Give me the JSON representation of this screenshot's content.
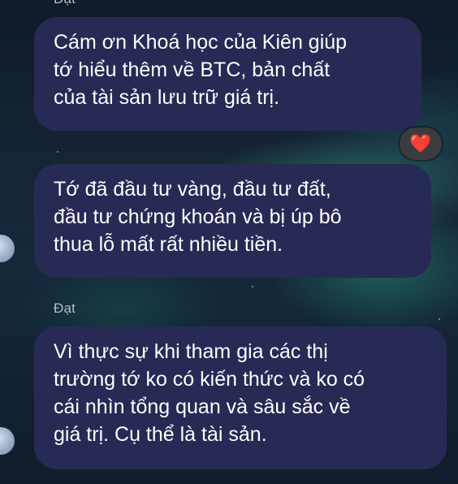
{
  "messages": [
    {
      "sender": "Đạt",
      "lines": [
        "Cám ơn Khoá học của Kiên giúp",
        "tớ hiểu thêm về BTC, bản chất",
        "của tài sản lưu trữ giá trị."
      ],
      "reaction": "❤️"
    },
    {
      "lines": [
        "Tớ đã đầu tư vàng, đầu tư đất,",
        "đầu tư chứng khoán và bị úp bô",
        "thua lỗ mất rất nhiều tiền."
      ]
    },
    {
      "sender": "Đạt",
      "lines": [
        "Vì thực sự khi tham gia các thị",
        "trường tớ ko có kiến thức và ko có",
        "cái nhìn tổng quan và sâu sắc về",
        "giá trị. Cụ thể là tài sản."
      ]
    }
  ],
  "colors": {
    "bubble": "#272a55",
    "reaction_heart": "#e02a36"
  }
}
